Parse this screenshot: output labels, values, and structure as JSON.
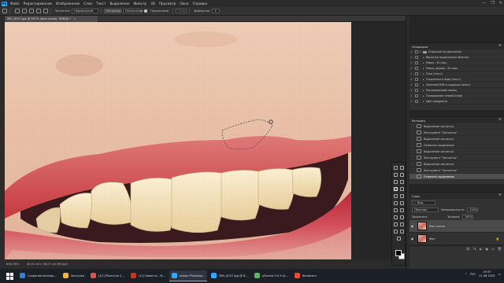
{
  "app": {
    "menu": [
      "Файл",
      "Редактирование",
      "Изображение",
      "Слои",
      "Текст",
      "Выделение",
      "Фильтр",
      "3D",
      "Просмотр",
      "Окно",
      "Справка"
    ],
    "logo": "Ps",
    "window_controls": [
      "—",
      "❐",
      "✕"
    ]
  },
  "options_bar": {
    "mode_label": "Заплатка:",
    "mode_value": "Нормальный",
    "source_label": "Источник",
    "dest_label": "Назначение",
    "transparent_label": "Прозрачный",
    "pattern_label": "Узор",
    "diffusion_label": "Диффузия:",
    "diffusion_value": "5"
  },
  "document": {
    "tab_title": "IMG_6257.jpg @ 637% (Фон копия, RGB/8) *",
    "close": "×",
    "status_zoom": "636,78%",
    "status_info": "48,51 см x 38,07 см (96 ppi)"
  },
  "actions_panel": {
    "title": "Операции",
    "rows": [
      {
        "check": "✓",
        "label": "Операции по умолчанию",
        "folder": true
      },
      {
        "check": "✓",
        "label": "Виньетка (выделенная область)"
      },
      {
        "check": "✓",
        "label": "Рамка - 50 пикс."
      },
      {
        "check": "✓",
        "label": "Рамка, дерево - 50 пикс."
      },
      {
        "check": "✓",
        "label": "Тень (текст)"
      },
      {
        "check": "✓",
        "label": "Отражение в воде (текст)"
      },
      {
        "check": "✓",
        "label": "Заказной RGB в градации серого"
      },
      {
        "check": "✓",
        "label": "Расплавленный свинец"
      },
      {
        "check": "✓",
        "label": "Тонирование сепией (слой)"
      },
      {
        "check": "✓",
        "label": "Цвет квадранта"
      }
    ]
  },
  "history_panel": {
    "title": "История",
    "rows": [
      {
        "label": "Выделение заплатки",
        "selected": false
      },
      {
        "label": "Инструмент \"Заплатка\"",
        "selected": false
      },
      {
        "label": "Выделение заплатки",
        "selected": false
      },
      {
        "label": "Отменить выделение",
        "selected": false
      },
      {
        "label": "Выделение заплатки",
        "selected": false
      },
      {
        "label": "Инструмент \"Заплатка\"",
        "selected": false
      },
      {
        "label": "Выделение заплатки",
        "selected": false
      },
      {
        "label": "Инструмент \"Заплатка\"",
        "selected": false
      },
      {
        "label": "Отменить выделение",
        "selected": true
      }
    ]
  },
  "layers_panel": {
    "title": "Слои",
    "search_value": "Вид",
    "blend_mode": "Обычные",
    "opacity_label": "Непрозрачность:",
    "opacity_value": "100%",
    "lock_label": "Закрепить:",
    "fill_label": "Заливка:",
    "fill_value": "100%",
    "layers": [
      {
        "name": "Фон копия",
        "selected": true
      },
      {
        "name": "Фон",
        "selected": false
      }
    ],
    "bottom_tools": [
      "⛓",
      "fx",
      "◐",
      "▣",
      "▭",
      "🗑"
    ]
  },
  "taskbar": {
    "items": [
      {
        "label": "Сохраним Балкар...",
        "color": "#3a7bd5",
        "active": false
      },
      {
        "label": "Загрузки",
        "color": "#e8b84a",
        "active": false
      },
      {
        "label": "[A7] Pinocchio 2...",
        "color": "#d9534f",
        "active": false
      },
      {
        "label": "(11) Новости - М...",
        "color": "#c0392b",
        "active": false
      },
      {
        "label": "Adobe Photosho...",
        "color": "#31a8ff",
        "active": true
      },
      {
        "label": "IMG_6257.jpg @ 6...",
        "color": "#31a8ff",
        "active": false
      },
      {
        "label": "µTorrent 3.5.5 (b...",
        "color": "#5cb85c",
        "active": false
      },
      {
        "label": "Bandicam",
        "color": "#e74c3c",
        "active": false
      }
    ],
    "time": "19:37",
    "date": "11.06.2020",
    "lang": "РУС"
  }
}
